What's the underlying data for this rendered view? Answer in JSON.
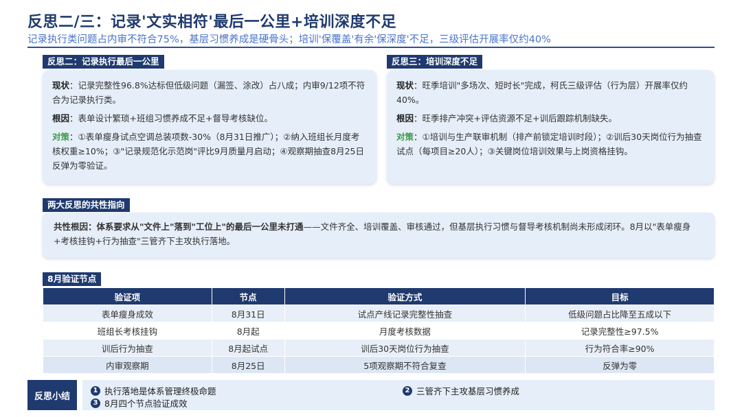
{
  "header": {
    "title": "反思二/三：记录'文实相符'最后一公里+培训深度不足",
    "subtitle": "记录执行类问题占内审不符合75%，基层习惯养成是硬骨头；培训'保覆盖'有余'保深度'不足，三级评估开展率仅约40%"
  },
  "reflection2": {
    "tag": "反思二：记录执行最后一公里",
    "status_label": "现状",
    "status_text": "：记录完整性96.8%达标但低级问题（漏签、涂改）占八成；内审9/12项不符合为记录执行类。",
    "cause_label": "根因",
    "cause_text": "：表单设计繁琐+班组习惯养成不足+督导考核缺位。",
    "measure_label": "对策",
    "measure_text": "：①表单瘦身试点空调总装项数-30%（8月31日推广）；②纳入班组长月度考核权重≥10%；③\"记录规范化示范岗\"评比9月质量月启动；④观察期抽查8月25日反弹为零验证。"
  },
  "reflection3": {
    "tag": "反思三：培训深度不足",
    "status_label": "现状",
    "status_text": "：旺季培训\"多场次、短时长\"完成，柯氏三级评估（行为层）开展率仅约40%。",
    "cause_label": "根因",
    "cause_text": "：旺季排产冲突+评估资源不足+训后跟踪机制缺失。",
    "measure_label": "对策",
    "measure_text": "：①培训与生产联审机制（排产前锁定培训时段）；②训后30天岗位行为抽查试点（每项目≥20人）；③关键岗位培训效果与上岗资格挂钩。"
  },
  "common": {
    "tag": "两大反思的共性指向",
    "label": "共性根因：体系要求从\"文件上\"落到\"工位上\"的最后一公里未打通",
    "text": "——文件齐全、培训覆盖、审核通过，但基层执行习惯与督导考核机制尚未形成闭环。8月以\"表单瘦身+考核挂钩+行为抽查\"三管齐下主攻执行落地。"
  },
  "nodes": {
    "tag": "8月验证节点",
    "headers": [
      "验证项",
      "节点",
      "验证方式",
      "目标"
    ],
    "rows": [
      [
        "表单瘦身成效",
        "8月31日",
        "试点产线记录完整性抽查",
        "低级问题占比降至五成以下"
      ],
      [
        "班组长考核挂钩",
        "8月起",
        "月度考核数据",
        "记录完整性≥97.5%"
      ],
      [
        "训后行为抽查",
        "8月起试点",
        "训后30天岗位行为抽查",
        "行为符合率≥90%"
      ],
      [
        "内审观察期",
        "8月25日",
        "5项观察期不符合复查",
        "反弹为零"
      ]
    ]
  },
  "summary": {
    "tag": "反思小结",
    "items": [
      {
        "num": "1",
        "text": "执行落地是体系管理终极命题"
      },
      {
        "num": "2",
        "text": "三管齐下主攻基层习惯养成"
      },
      {
        "num": "3",
        "text": "8月四个节点验证成效"
      }
    ]
  },
  "colors": {
    "navy": "#1f3a6e",
    "accent_blue": "#4a74c9",
    "card_bg": "#e6eef9",
    "measure_green": "#3d9a4a"
  }
}
